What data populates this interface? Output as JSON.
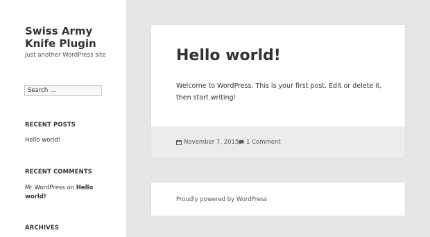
{
  "sidebar": {
    "site_title": "Swiss Army Knife Plugin",
    "site_description": "Just another WordPress site",
    "search_placeholder": "Search …",
    "recent_posts_title": "RECENT POSTS",
    "recent_posts": [
      "Hello world!"
    ],
    "recent_comments_title": "RECENT COMMENTS",
    "recent_comment": {
      "author": "Mr WordPress",
      "on": "on",
      "post": "Hello world!"
    },
    "archives_title": "ARCHIVES"
  },
  "article": {
    "title": "Hello world!",
    "content": "Welcome to WordPress. This is your first post. Edit or delete it, then start writing!",
    "date": "November 7, 2015",
    "comments": "1 Comment",
    "date_icon": "calendar-icon",
    "comments_icon": "comment-icon"
  },
  "footer": {
    "text": "Proudly powered by WordPress"
  },
  "colors": {
    "background": "#e6e6e6",
    "panel": "#ffffff",
    "entry_footer": "#ececec",
    "text": "#333333"
  }
}
